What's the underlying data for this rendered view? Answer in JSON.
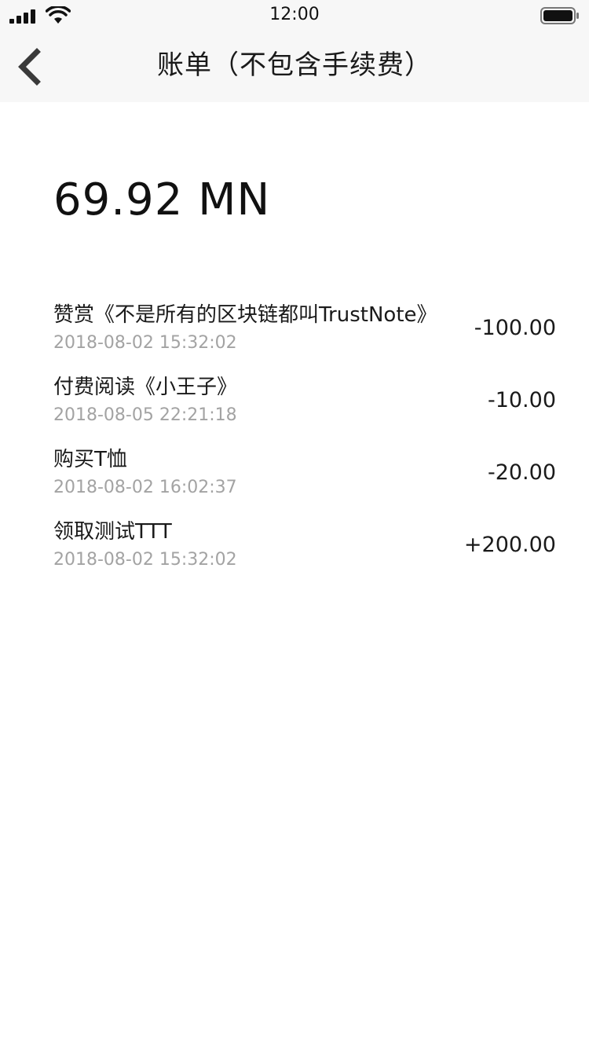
{
  "status_bar": {
    "time": "12:00",
    "signal_icon": "cellular-signal-icon",
    "wifi_icon": "wifi-icon",
    "battery_icon": "battery-full-icon"
  },
  "nav": {
    "back_icon": "chevron-left-icon",
    "title": "账单（不包含手续费）"
  },
  "balance": "69.92 MN",
  "transactions": [
    {
      "title": "赞赏《不是所有的区块链都叫TrustNote》",
      "time": "2018-08-02 15:32:02",
      "amount": "-100.00"
    },
    {
      "title": "付费阅读《小王子》",
      "time": "2018-08-05 22:21:18",
      "amount": "-10.00"
    },
    {
      "title": "购买T恤",
      "time": "2018-08-02 16:02:37",
      "amount": "-20.00"
    },
    {
      "title": "领取测试TTT",
      "time": "2018-08-02 15:32:02",
      "amount": "+200.00"
    }
  ],
  "colors": {
    "bar_background": "#f7f7f7",
    "text_primary": "#1a1a1a",
    "text_secondary": "#a3a3a3"
  }
}
